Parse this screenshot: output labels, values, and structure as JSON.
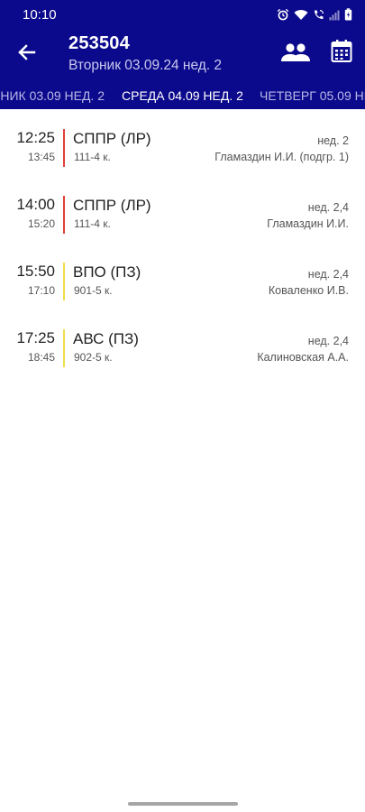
{
  "status_bar": {
    "time": "10:10",
    "icons": [
      "alarm-icon",
      "wifi-icon",
      "wifi-calling-icon",
      "signal-icon",
      "battery-icon"
    ]
  },
  "header": {
    "title": "253504",
    "subtitle": "Вторник 03.09.24 нед. 2",
    "background_color": "#0c0a8c",
    "back_icon": "arrow-back-icon",
    "actions": [
      "group-icon",
      "calendar-icon"
    ]
  },
  "tabs": [
    {
      "label": "НИК 03.09 НЕД. 2",
      "active": false
    },
    {
      "label": "СРЕДА 04.09 НЕД. 2",
      "active": true
    },
    {
      "label": "ЧЕТВЕРГ 05.09 НЕ",
      "active": false
    }
  ],
  "lessons": [
    {
      "start": "12:25",
      "end": "13:45",
      "subject": "СППР (ЛР)",
      "room": "111-4 к.",
      "week": "нед. 2",
      "teacher": "Гламаздин И.И. (подгр. 1)",
      "color": "#e0403a"
    },
    {
      "start": "14:00",
      "end": "15:20",
      "subject": "СППР (ЛР)",
      "room": "111-4 к.",
      "week": "нед. 2,4",
      "teacher": "Гламаздин И.И.",
      "color": "#e0403a"
    },
    {
      "start": "15:50",
      "end": "17:10",
      "subject": "ВПО (ПЗ)",
      "room": "901-5 к.",
      "week": "нед. 2,4",
      "teacher": "Коваленко И.В.",
      "color": "#f2dd4a"
    },
    {
      "start": "17:25",
      "end": "18:45",
      "subject": "АВС (ПЗ)",
      "room": "902-5 к.",
      "week": "нед. 2,4",
      "teacher": "Калиновская А.А.",
      "color": "#f2dd4a"
    }
  ]
}
